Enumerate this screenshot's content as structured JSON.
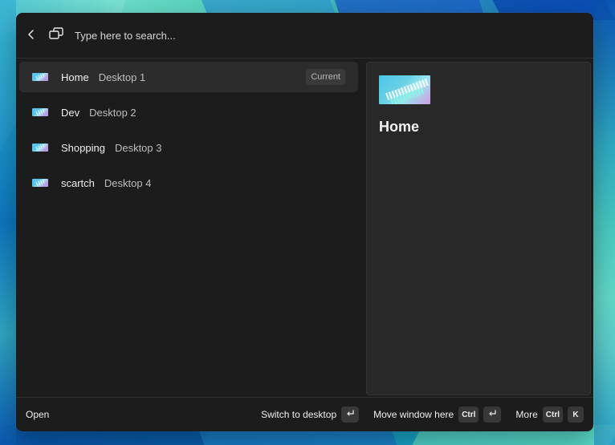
{
  "search": {
    "placeholder": "Type here to search..."
  },
  "desktops": [
    {
      "name": "Home",
      "desktop": "Desktop 1",
      "badge": "Current"
    },
    {
      "name": "Dev",
      "desktop": "Desktop 2"
    },
    {
      "name": "Shopping",
      "desktop": "Desktop 3"
    },
    {
      "name": "scartch",
      "desktop": "Desktop 4"
    }
  ],
  "preview": {
    "title": "Home"
  },
  "footer": {
    "open": "Open",
    "switch_label": "Switch to desktop",
    "move_label": "Move window here",
    "more_label": "More",
    "ctrl_key": "Ctrl",
    "k_key": "K"
  },
  "icons": {
    "back": "back-icon",
    "switcher": "desktop-switcher-icon",
    "enter": "enter-key-icon"
  },
  "colors": {
    "window_background": "#1c1c1c",
    "preview_background": "#282828",
    "selected_item": "#2c2c2c",
    "badge_background": "#3a3a3a"
  }
}
